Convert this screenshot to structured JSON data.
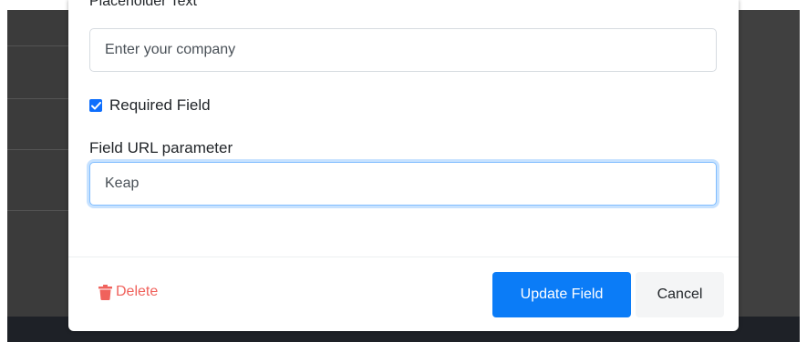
{
  "form": {
    "placeholder_label": "Placeholder Text",
    "placeholder_value": "Enter your company",
    "required_label": "Required Field",
    "required_checked": true,
    "url_param_label": "Field URL parameter",
    "url_param_value": "Keap"
  },
  "footer": {
    "delete_label": "Delete",
    "update_label": "Update Field",
    "cancel_label": "Cancel"
  },
  "colors": {
    "accent": "#0b7cf7",
    "danger": "#f0625c",
    "focus_ring": "#80bdff"
  },
  "icons": {
    "delete": "trash-icon",
    "checkbox": "check-icon"
  }
}
